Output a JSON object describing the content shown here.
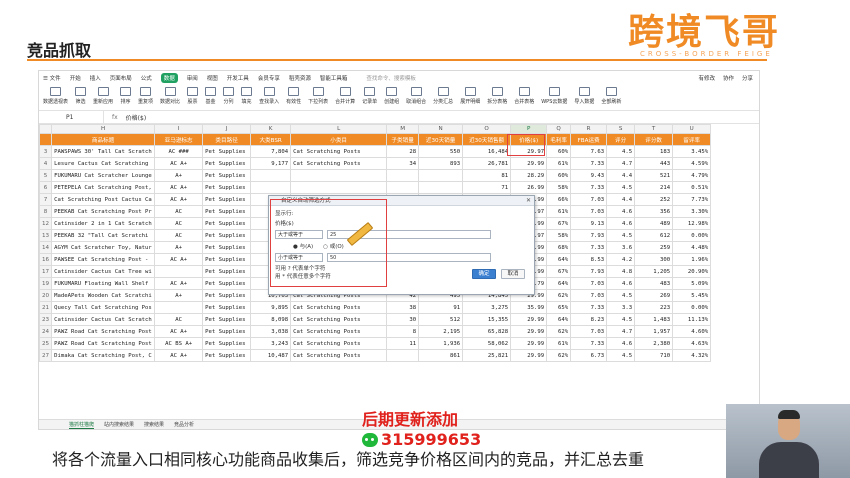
{
  "slide": {
    "title": "竞品抓取",
    "brand": "跨境飞哥",
    "brand_sub": "CROSS-BORDER FEIGE",
    "caption": "将各个流量入口相同核心功能商品收集后，筛选竞争价格区间内的竞品，并汇总去重",
    "promo": "后期更新添加",
    "wechat_id": "315999653",
    "accent_color": "#f08a24",
    "promo_color": "#e0211c"
  },
  "menubar": {
    "items": [
      "☰ 文件",
      "开始",
      "插入",
      "页面布局",
      "公式",
      "数据",
      "审阅",
      "视图",
      "开发工具",
      "会员专享",
      "稻壳资源",
      "智能工具箱"
    ],
    "active": "数据",
    "search": "查找命令、搜索模板",
    "right": [
      "有修改",
      "协作",
      "分享"
    ]
  },
  "ribbon": {
    "items": [
      "数据透视表",
      "筛选",
      "重新应用",
      "排序",
      "重复项",
      "数据对比",
      "股票",
      "基金",
      "分列",
      "填充",
      "查找录入",
      "有效性",
      "下拉列表",
      "合并计算",
      "记录单",
      "创建组",
      "取消组合",
      "分类汇总",
      "展开明细",
      "拆分表格",
      "合并表格",
      "WPS云数据",
      "导入数据",
      "全部刷新"
    ]
  },
  "formula": {
    "cellref": "P1",
    "fx": "fx",
    "value": "价格($)"
  },
  "grid": {
    "col_letters": [
      "",
      "H",
      "I",
      "J",
      "K",
      "L",
      "M",
      "N",
      "O",
      "P",
      "Q",
      "R",
      "S",
      "T",
      "U"
    ],
    "selected_col": "P",
    "headers": [
      "商品标题",
      "亚马逊标志",
      "类目路径",
      "大类BSR",
      "小类目",
      "子类销量",
      "近30天销量",
      "近30天销售额",
      "价格($)",
      "毛利率",
      "FBA运费",
      "评分",
      "评分数",
      "留评率"
    ],
    "rows": [
      {
        "n": "3",
        "c": [
          "PAWSPAWS 30' Tall Cat Scratch",
          "AC ###",
          "Pet Supplies",
          "7,804",
          "Cat Scratching Posts",
          "28",
          "550",
          "16,484",
          "29.97",
          "60%",
          "7.63",
          "4.5",
          "183",
          "3.45%"
        ]
      },
      {
        "n": "4",
        "c": [
          "Lesure Cactus Cat Scratching",
          "AC A+",
          "Pet Supplies",
          "9,177",
          "Cat Scratching Posts",
          "34",
          "893",
          "26,781",
          "29.99",
          "61%",
          "7.33",
          "4.7",
          "443",
          "4.59%"
        ]
      },
      {
        "n": "5",
        "c": [
          "FUKUMARU Cat Scratcher Lounge",
          "A+",
          "Pet Supplies",
          "",
          "",
          "",
          "",
          "81",
          "28.29",
          "60%",
          "9.43",
          "4.4",
          "521",
          "4.79%"
        ]
      },
      {
        "n": "6",
        "c": [
          "PETEPELA Cat Scratching Post,",
          "AC A+",
          "Pet Supplies",
          "",
          "",
          "",
          "",
          "71",
          "26.99",
          "58%",
          "7.33",
          "4.5",
          "214",
          "0.51%"
        ]
      },
      {
        "n": "7",
        "c": [
          "Cat Scratching Post Cactus Ca",
          "AC A+",
          "Pet Supplies",
          "",
          "",
          "",
          "",
          "99",
          "36.99",
          "66%",
          "7.03",
          "4.4",
          "252",
          "7.73%"
        ]
      },
      {
        "n": "8",
        "c": [
          "PEEKAB Cat Scratching Post Pr",
          "AC",
          "Pet Supplies",
          "",
          "",
          "",
          "",
          "26",
          "29.97",
          "61%",
          "7.03",
          "4.6",
          "356",
          "3.30%"
        ]
      },
      {
        "n": "12",
        "c": [
          "Catinsider 2 in 1 Cat Scratch",
          "AC",
          "Pet Supplies",
          "",
          "",
          "",
          "",
          "46",
          "49.99",
          "67%",
          "9.13",
          "4.6",
          "489",
          "12.98%"
        ]
      },
      {
        "n": "13",
        "c": [
          "PEEKAB 32 \"Tall Cat Scratchi",
          "AC",
          "Pet Supplies",
          "",
          "",
          "",
          "",
          "47",
          "27.97",
          "58%",
          "7.93",
          "4.5",
          "612",
          "0.00%"
        ]
      },
      {
        "n": "14",
        "c": [
          "AGYM Cat Scratcher Toy, Natur",
          "A+",
          "Pet Supplies",
          "",
          "",
          "",
          "",
          "00",
          "42.99",
          "68%",
          "7.33",
          "3.6",
          "259",
          "4.48%"
        ]
      },
      {
        "n": "16",
        "c": [
          "PAWSEE Cat Scratching Post -",
          "AC A+",
          "Pet Supplies",
          "",
          "",
          "",
          "",
          "81",
          "39.99",
          "64%",
          "8.53",
          "4.2",
          "300",
          "1.96%"
        ]
      },
      {
        "n": "17",
        "c": [
          "Catinsider Cactus Cat Tree wi",
          "",
          "Pet Supplies",
          "13,347",
          "Cat Scratching Posts",
          "50",
          "445",
          "20,021",
          "44.99",
          "67%",
          "7.93",
          "4.8",
          "1,205",
          "20.90%"
        ]
      },
      {
        "n": "19",
        "c": [
          "FUKUMARU Floating Wall Shelf",
          "AC A+",
          "Pet Supplies",
          "8,174",
          "Cat Scratching Posts",
          "32",
          "753",
          "23,938",
          "31.79",
          "64%",
          "7.03",
          "4.6",
          "483",
          "5.09%"
        ]
      },
      {
        "n": "20",
        "c": [
          "MadeAPets Wooden Cat Scratchi",
          "A+",
          "Pet Supplies",
          "10,703",
          "Cat Scratching Posts",
          "42",
          "495",
          "14,845",
          "29.99",
          "62%",
          "7.03",
          "4.5",
          "269",
          "5.45%"
        ]
      },
      {
        "n": "21",
        "c": [
          "Quecy Tall Cat Scratching Pos",
          "",
          "Pet Supplies",
          "9,895",
          "Cat Scratching Posts",
          "38",
          "91",
          "3,275",
          "35.99",
          "65%",
          "7.33",
          "3.3",
          "223",
          "0.00%"
        ]
      },
      {
        "n": "23",
        "c": [
          "Catinsider Cactus Cat Scratch",
          "AC",
          "Pet Supplies",
          "8,098",
          "Cat Scratching Posts",
          "30",
          "512",
          "15,355",
          "29.99",
          "64%",
          "8.23",
          "4.5",
          "1,483",
          "11.13%"
        ]
      },
      {
        "n": "24",
        "c": [
          "PAWZ Road Cat Scratching Post",
          "AC A+",
          "Pet Supplies",
          "3,038",
          "Cat Scratching Posts",
          "8",
          "2,195",
          "65,828",
          "29.99",
          "62%",
          "7.03",
          "4.7",
          "1,957",
          "4.60%"
        ]
      },
      {
        "n": "25",
        "c": [
          "PAWZ Road Cat Scratching Post",
          "AC BS A+",
          "Pet Supplies",
          "3,243",
          "Cat Scratching Posts",
          "11",
          "1,936",
          "58,062",
          "29.99",
          "61%",
          "7.33",
          "4.6",
          "2,380",
          "4.63%"
        ]
      },
      {
        "n": "27",
        "c": [
          "Dimaka Cat Scratching Post, C",
          "AC A+",
          "Pet Supplies",
          "10,487",
          "Cat Scratching Posts",
          "",
          "861",
          "25,821",
          "29.99",
          "62%",
          "6.73",
          "4.5",
          "710",
          "4.32%"
        ]
      }
    ]
  },
  "sheet_tabs": [
    "猫抓柱猫爬",
    "站内搜索结果",
    "搜索结果",
    "竞品分析"
  ],
  "dialog": {
    "title": "自定义自动筛选方式",
    "show_rows": "显示行:",
    "field": "价格($)",
    "cond1_op": "大于或等于",
    "cond1_val": "25",
    "and_label": "与(A)",
    "or_label": "或(O)",
    "cond2_op": "小于或等于",
    "cond2_val": "50",
    "note1": "可用 ? 代表单个字符",
    "note2": "用 * 代表任意多个字符",
    "ok": "确定",
    "cancel": "取消"
  }
}
